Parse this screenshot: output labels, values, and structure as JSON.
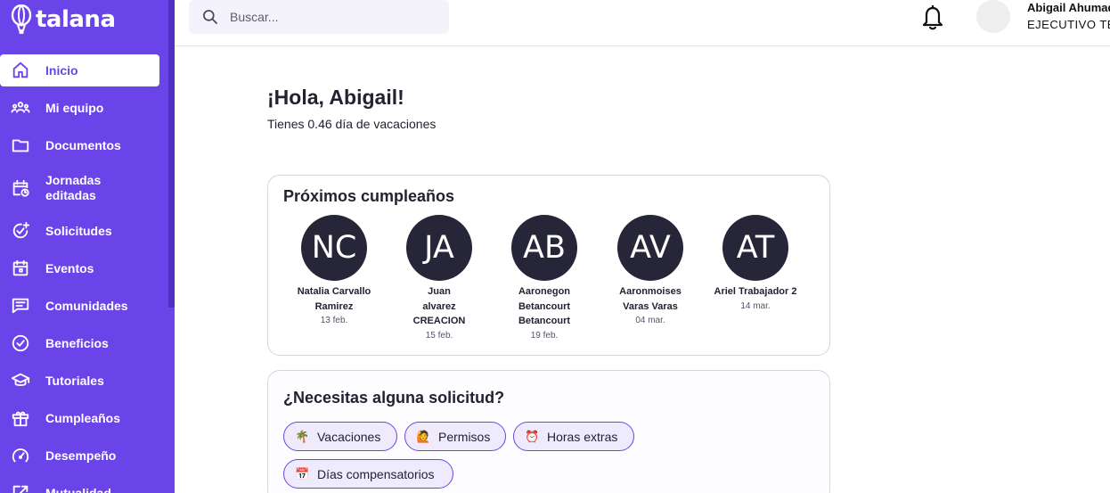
{
  "brand": {
    "logo_text": "talana"
  },
  "sidebar": {
    "items": [
      {
        "label": "Inicio",
        "icon": "home-icon",
        "active": true
      },
      {
        "label": "Mi equipo",
        "icon": "team-icon"
      },
      {
        "label": "Documentos",
        "icon": "folder-icon"
      },
      {
        "label": "Jornadas editadas",
        "icon": "calendar-clock-icon"
      },
      {
        "label": "Solicitudes",
        "icon": "check-plus-icon"
      },
      {
        "label": "Eventos",
        "icon": "calendar-icon"
      },
      {
        "label": "Comunidades",
        "icon": "chat-icon"
      },
      {
        "label": "Beneficios",
        "icon": "check-circle-icon"
      },
      {
        "label": "Tutoriales",
        "icon": "graduation-cap-icon"
      },
      {
        "label": "Cumpleaños",
        "icon": "gift-icon"
      },
      {
        "label": "Desempeño",
        "icon": "gauge-icon"
      },
      {
        "label": "Mutualidad",
        "icon": "external-link-icon"
      }
    ]
  },
  "topbar": {
    "search_placeholder": "Buscar...",
    "user_name": "Abigail Ahumada",
    "user_role": "EJECUTIVO TECNICO"
  },
  "main": {
    "greeting": "¡Hola, Abigail!",
    "vacation_text": "Tienes 0.46 día de vacaciones"
  },
  "birthdays": {
    "title": "Próximos cumpleaños",
    "people": [
      {
        "initials": "NC",
        "name": "Natalia Carvallo Ramirez",
        "date": "13 feb."
      },
      {
        "initials": "JA",
        "name": "Juan alvarez CREACION",
        "date": "15 feb."
      },
      {
        "initials": "AB",
        "name": "Aaronegon Betancourt Betancourt",
        "date": "19 feb."
      },
      {
        "initials": "AV",
        "name": "Aaronmoises Varas Varas",
        "date": "04 mar."
      },
      {
        "initials": "AT",
        "name": "Ariel Trabajador 2",
        "date": "14 mar."
      }
    ]
  },
  "requests": {
    "title": "¿Necesitas alguna solicitud?",
    "chips": [
      {
        "emoji": "🌴",
        "label": "Vacaciones"
      },
      {
        "emoji": "🙋",
        "label": "Permisos"
      },
      {
        "emoji": "⏰",
        "label": "Horas extras"
      },
      {
        "emoji": "📅",
        "label": "Días compensatorios"
      }
    ]
  }
}
